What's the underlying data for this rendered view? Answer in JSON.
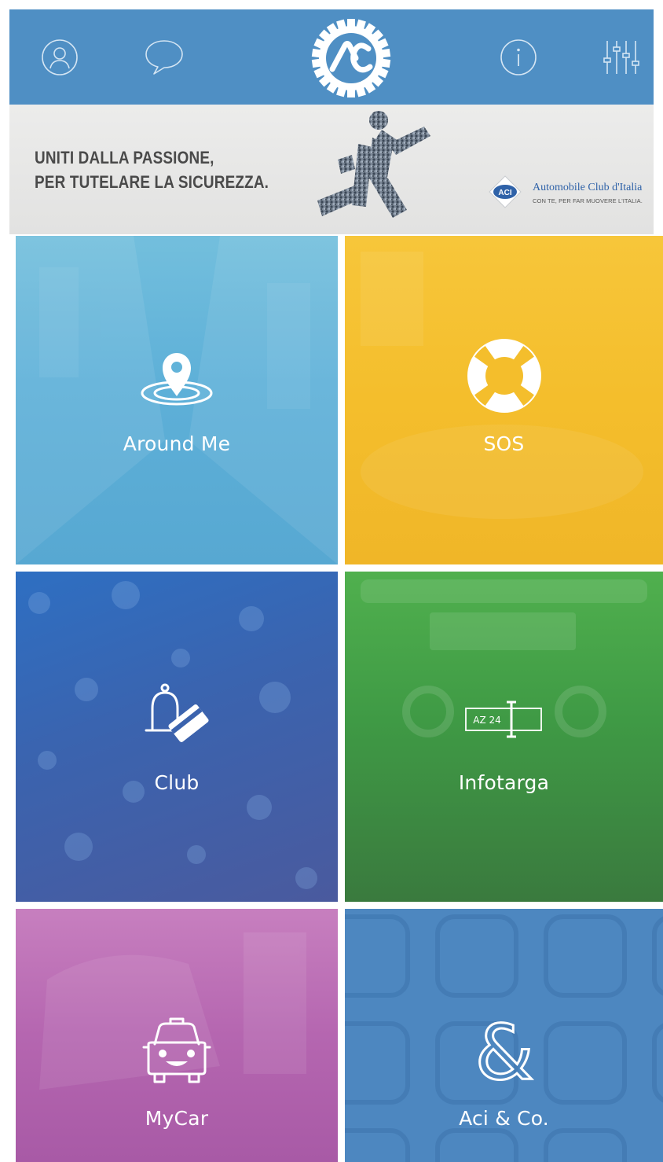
{
  "header": {
    "icons": {
      "profile": "user-icon",
      "chat": "chat-bubble-icon",
      "logo": "aci-logo-icon",
      "info": "info-icon",
      "settings": "settings-sliders-icon"
    },
    "color": "#4f8fc4"
  },
  "banner": {
    "line1": "UNITI DALLA  PASSIONE,",
    "line2": "PER TUTELARE  LA SICUREZZA.",
    "brand_name": "Automobile Club d'Italia",
    "brand_tagline": "CON TE, PER FAR MUOVERE L'ITALIA."
  },
  "tiles": [
    {
      "label": "Around Me",
      "icon": "location-pin-icon",
      "color": "#62b3d9"
    },
    {
      "label": "SOS",
      "icon": "lifebuoy-icon",
      "color": "#f4be2c"
    },
    {
      "label": "Club",
      "icon": "bell-card-icon",
      "color": "#3b63ae"
    },
    {
      "label": "Infotarga",
      "icon": "license-plate-icon",
      "color": "#45a047",
      "plate_text": "AZ 24"
    },
    {
      "label": "MyCar",
      "icon": "smiling-car-icon",
      "color": "#b86aaf"
    },
    {
      "label": "Aci & Co.",
      "icon": "ampersand-icon",
      "color": "#4d87c0"
    }
  ]
}
